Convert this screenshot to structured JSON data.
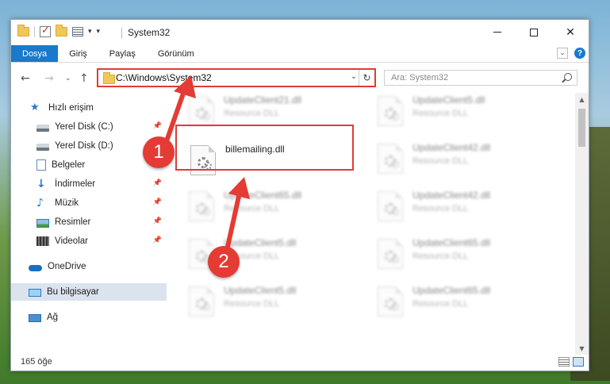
{
  "title_bar": {
    "title": "System32"
  },
  "ribbon": {
    "tabs": [
      "Dosya",
      "Giriş",
      "Paylaş",
      "Görünüm"
    ]
  },
  "address": {
    "path": "C:\\Windows\\System32",
    "search_placeholder": "Ara: System32"
  },
  "nav_pane": {
    "items": [
      {
        "label": "Hızlı erişim",
        "icon": "star-icon"
      },
      {
        "label": "Yerel Disk (C:)",
        "icon": "disk-icon",
        "pinned": true
      },
      {
        "label": "Yerel Disk (D:)",
        "icon": "disk-icon",
        "pinned": true
      },
      {
        "label": "Belgeler",
        "icon": "document-icon",
        "pinned": true
      },
      {
        "label": "İndirmeler",
        "icon": "download-icon",
        "pinned": true
      },
      {
        "label": "Müzik",
        "icon": "music-icon",
        "pinned": true
      },
      {
        "label": "Resimler",
        "icon": "pictures-icon",
        "pinned": true
      },
      {
        "label": "Videolar",
        "icon": "video-icon",
        "pinned": true
      },
      {
        "label": "OneDrive",
        "icon": "cloud-icon"
      },
      {
        "label": "Bu bilgisayar",
        "icon": "computer-icon",
        "selected": true
      },
      {
        "label": "Ağ",
        "icon": "network-icon"
      }
    ]
  },
  "files": [
    {
      "name": "UpdateClient21.dll",
      "type": "Resource DLL"
    },
    {
      "name": "UpdateClient5.dll",
      "type": "Resource DLL"
    },
    {
      "name": "billemailing.dll",
      "type": ""
    },
    {
      "name": "UpdateClient42.dll",
      "type": "Resource DLL"
    },
    {
      "name": "UpdateClient65.dll",
      "type": "Resource DLL"
    },
    {
      "name": "UpdateClient42.dll",
      "type": "Resource DLL"
    },
    {
      "name": "UpdateClient5.dll",
      "type": "Resource DLL"
    },
    {
      "name": "UpdateClient65.dll",
      "type": "Resource DLL"
    },
    {
      "name": "UpdateClient5.dll",
      "type": "Resource DLL"
    },
    {
      "name": "UpdateClient65.dll",
      "type": "Resource DLL"
    }
  ],
  "status": {
    "count": "165 öğe"
  },
  "callouts": {
    "one": "1",
    "two": "2"
  },
  "colors": {
    "accent": "#1979ca",
    "highlight": "#e03b36"
  }
}
